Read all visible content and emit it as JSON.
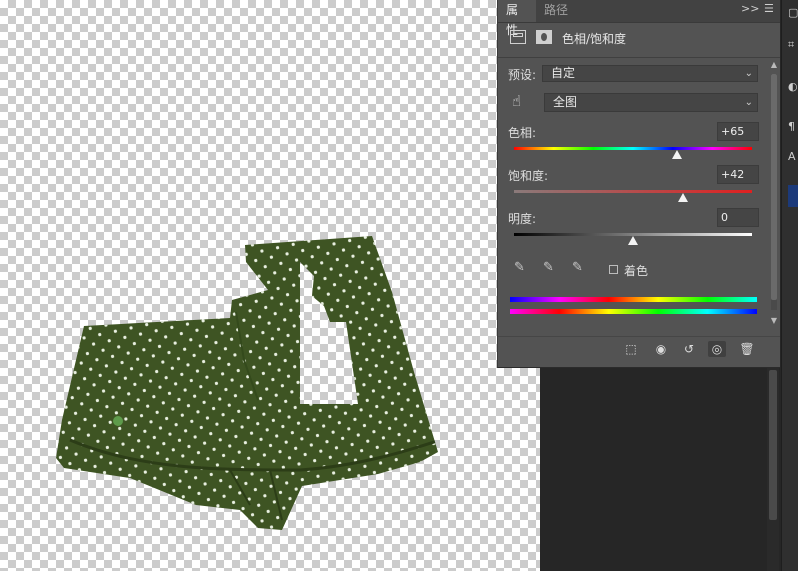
{
  "panel": {
    "tabs": [
      {
        "label": "属性"
      },
      {
        "label": "路径"
      }
    ],
    "expand_icon": "double-chevron-right-icon",
    "menu_icon": "hamburger-menu-icon",
    "header_title": "色相/饱和度",
    "preset": {
      "label": "预设:",
      "value": "自定"
    },
    "range": {
      "value": "全图"
    },
    "hue": {
      "label": "色相:",
      "value": "+65",
      "level": 0.684
    },
    "saturation": {
      "label": "饱和度:",
      "value": "+42",
      "level": 0.71
    },
    "lightness": {
      "label": "明度:",
      "value": "0",
      "level": 0.5
    },
    "colorize": {
      "label": "着色",
      "checked": false
    },
    "footer_icons": [
      "clip-to-layer-icon",
      "view-previous-icon",
      "reset-icon",
      "visibility-eye-icon",
      "trash-icon"
    ]
  },
  "colors": {
    "panel_bg": "#535353",
    "fabric": "#3e5423",
    "accent_button": "#5e9b4b"
  }
}
